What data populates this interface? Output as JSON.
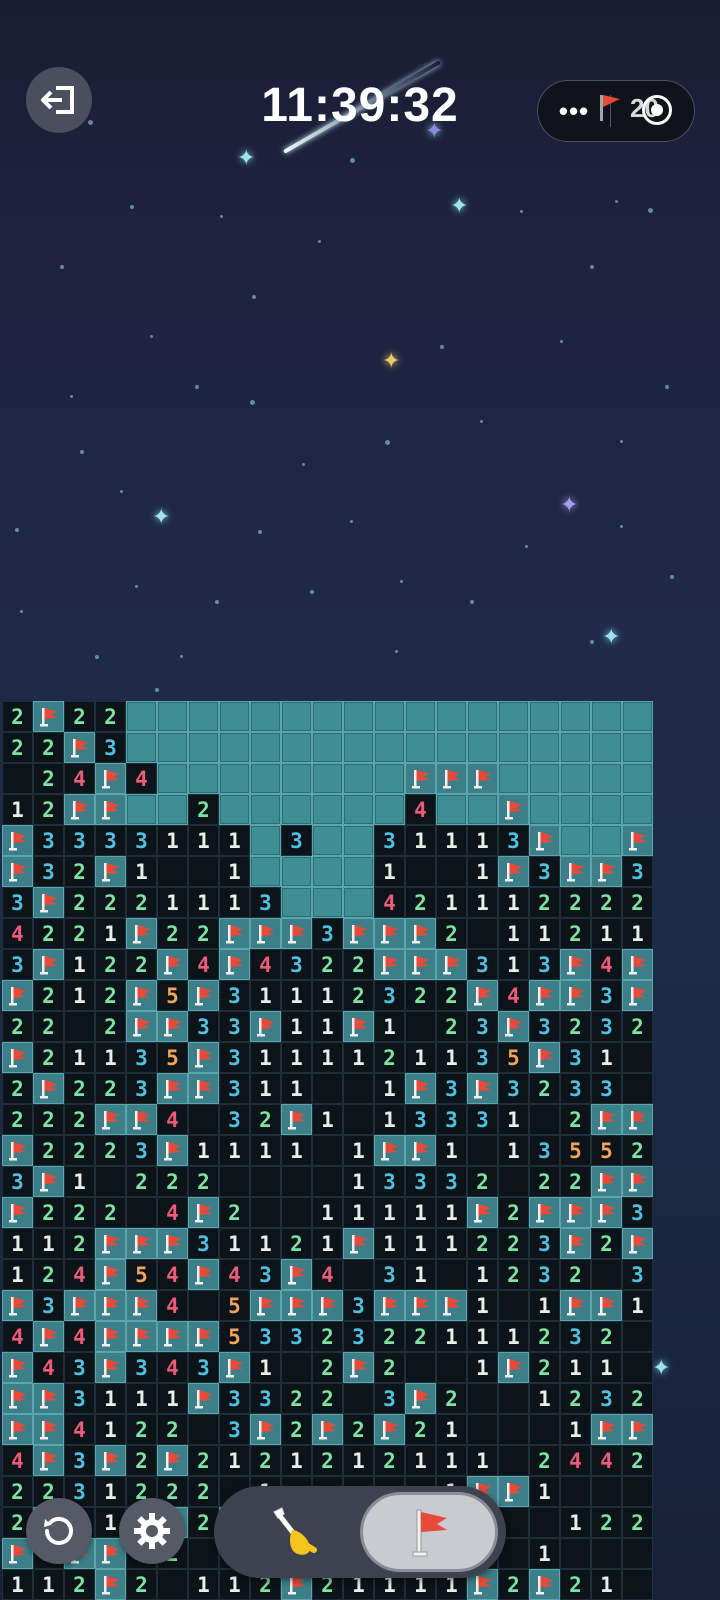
{
  "header": {
    "clock": "11:39:32",
    "flag_count": "20",
    "more_label": "•••"
  },
  "icons": {
    "exit": "exit-icon",
    "restart": "restart-icon",
    "settings": "gear-icon",
    "dig": "shovel-icon",
    "flag": "flag-icon",
    "target": "target-icon"
  },
  "colors": {
    "hidden_cell": "#3f8d95",
    "revealed_cell": "#0c1419",
    "num1": "#e8efe9",
    "num2": "#7ee2a2",
    "num3": "#4fc0e0",
    "num4": "#ef5a7a",
    "num5": "#f3a35a",
    "flag_red": "#e84a3a",
    "active_mode": "#c9cbd1"
  },
  "board": {
    "columns": 21,
    "legend": "# = hidden, F = flag, . = empty, digit = mine count",
    "rows": [
      "2F22#################",
      "22F3#################",
      ".24F4########FFF#####",
      "12FF##2######4##F####",
      "F3333111#3##31113F##FF",
      "F32F1..1####1..1F3FF3",
      "3F2221113###4211122221",
      "4221F22FFF3FFF2.11211",
      "3F122F4F4322FFF313F4F2",
      "F212F5F31112322F4FF3F",
      "22.2FF33F11F1.23F3232",
      "F21135F3111121135F31.1F",
      "2F223FF311..1F3F3233 2",
      "222FF4 32F1.13331 2FFF2",
      "F2223F1111.1FF1.13552F",
      "3F1.222....13332 22FF2",
      "F222 4F2..11111F2FFF342",
      "112FFF31121F111223F2F2",
      "124F54F43F4 31.1232 34F",
      "F3FFF4 5FFF3FFF1.1FF1 2FF",
      "4F4FFFF5332322111232 3F3",
      "F43F343F1.2F2..1F211",
      "FF3111F3322 3F2..12321",
      "FF4122 3F2F2F21...1FF1",
      "4F3F2F2121212111.2442",
      "2231222 1.....1FF1",
      "2F21.F2F..........1221",
      "F3FF.2.1.........1...",
      "112F2.112F21111F2F21..."
    ]
  }
}
